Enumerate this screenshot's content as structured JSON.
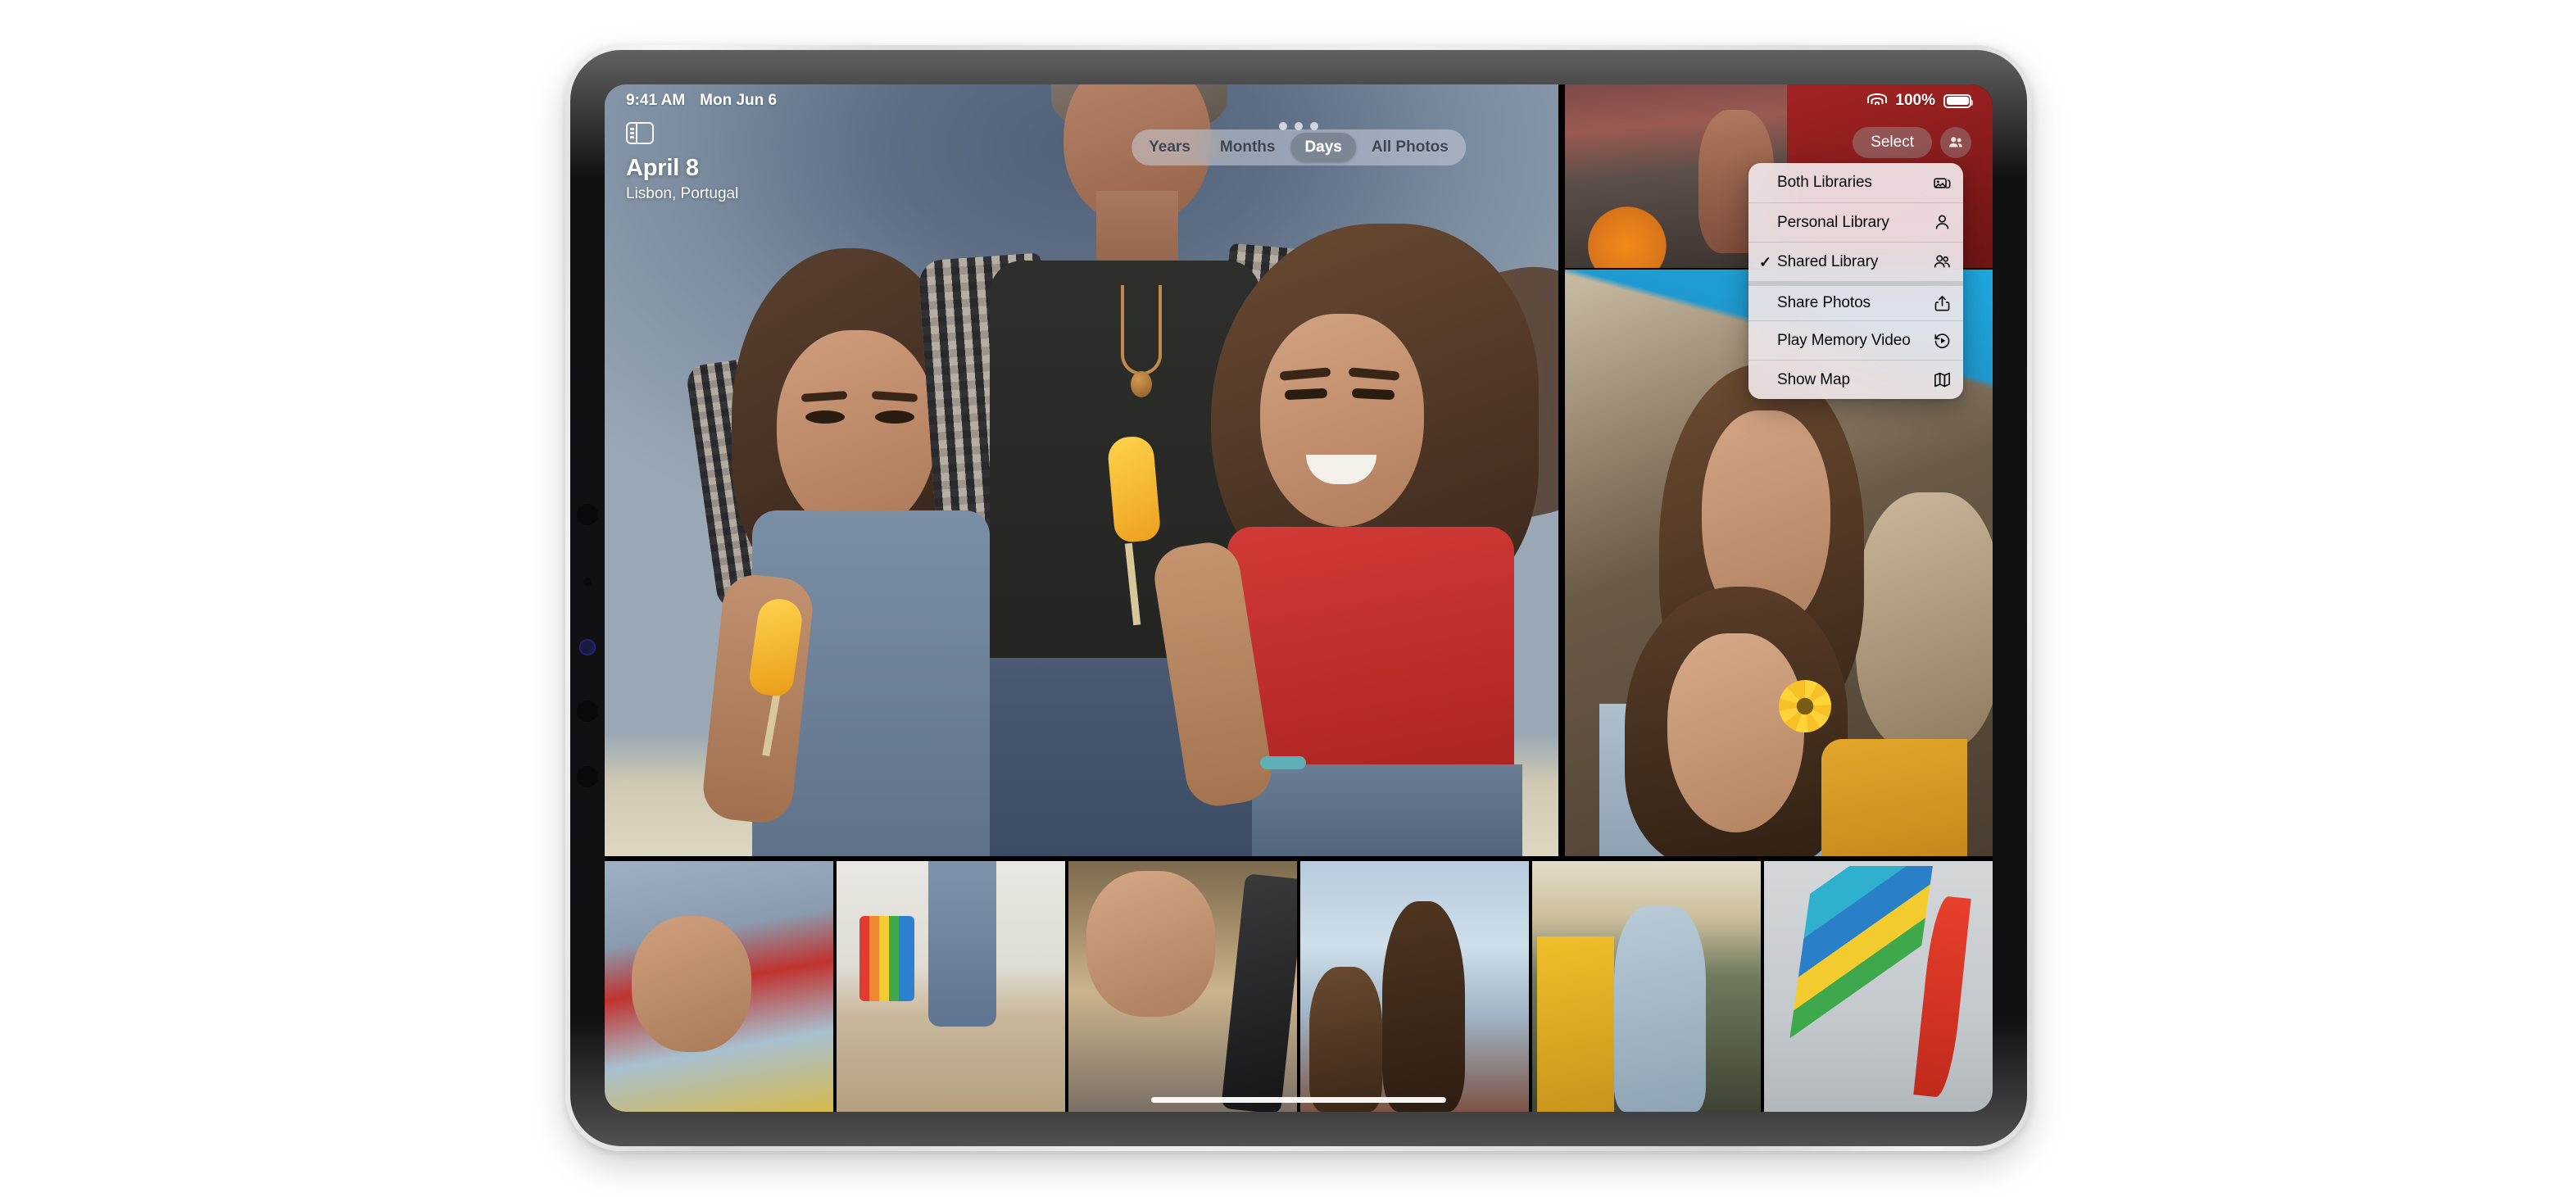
{
  "statusbar": {
    "time": "9:41 AM",
    "date": "Mon Jun 6",
    "wifi_icon": "wifi-icon",
    "battery_percent": "100%",
    "battery_icon": "battery-full-icon"
  },
  "toolbar": {
    "sidebar_toggle_icon": "sidebar-toggle-icon",
    "multitask_grabber_icon": "multitask-grabber-icon",
    "select_label": "Select",
    "shared_library_icon": "people-two-icon"
  },
  "header": {
    "title": "April 8",
    "subtitle": "Lisbon, Portugal"
  },
  "segmented_control": {
    "selected": "Days",
    "options": [
      {
        "label": "Years",
        "selected": false
      },
      {
        "label": "Months",
        "selected": false
      },
      {
        "label": "Days",
        "selected": true
      },
      {
        "label": "All Photos",
        "selected": false
      }
    ]
  },
  "context_menu": {
    "items": [
      {
        "label": "Both Libraries",
        "icon": "photo-stack-icon",
        "checked": false,
        "group": 0
      },
      {
        "label": "Personal Library",
        "icon": "person-icon",
        "checked": false,
        "group": 0
      },
      {
        "label": "Shared Library",
        "icon": "people-two-icon",
        "checked": true,
        "group": 0
      },
      {
        "label": "Share Photos",
        "icon": "share-up-icon",
        "checked": false,
        "group": 1
      },
      {
        "label": "Play Memory Video",
        "icon": "play-rewind-icon",
        "checked": false,
        "group": 1
      },
      {
        "label": "Show Map",
        "icon": "map-icon",
        "checked": false,
        "group": 1
      }
    ],
    "check_glyph": "✓"
  },
  "photo_grid": {
    "hero": {
      "name": "hero-photo",
      "alt": "Man with two girls holding popsicles at the beach"
    },
    "right_column": [
      {
        "name": "photo-girl-with-ball",
        "alt": "Girl in van with orange football"
      },
      {
        "name": "photo-red-van",
        "alt": "Red van exterior"
      },
      {
        "name": "photo-girls-with-flower",
        "alt": "Two girls and a dog in a van with a yellow flower"
      }
    ],
    "thumbnails": [
      {
        "name": "thumb-girl-lying-down",
        "alt": "Girl in red shirt lying down"
      },
      {
        "name": "thumb-kite-beach-feet",
        "alt": "Bare feet on sand with kite"
      },
      {
        "name": "thumb-girl-close-up",
        "alt": "Close-up of girl by car window"
      },
      {
        "name": "thumb-girls-sky",
        "alt": "Two girls against a cloudy sky"
      },
      {
        "name": "thumb-girl-in-van",
        "alt": "Girl looking out of van window"
      },
      {
        "name": "thumb-kite",
        "alt": "Colorful kite against grey sky"
      }
    ]
  },
  "colors": {
    "accent_selected": "#7a8290",
    "menu_background": "#eee5e7",
    "screen_background": "#000000"
  },
  "home_indicator": {
    "name": "home-indicator"
  }
}
